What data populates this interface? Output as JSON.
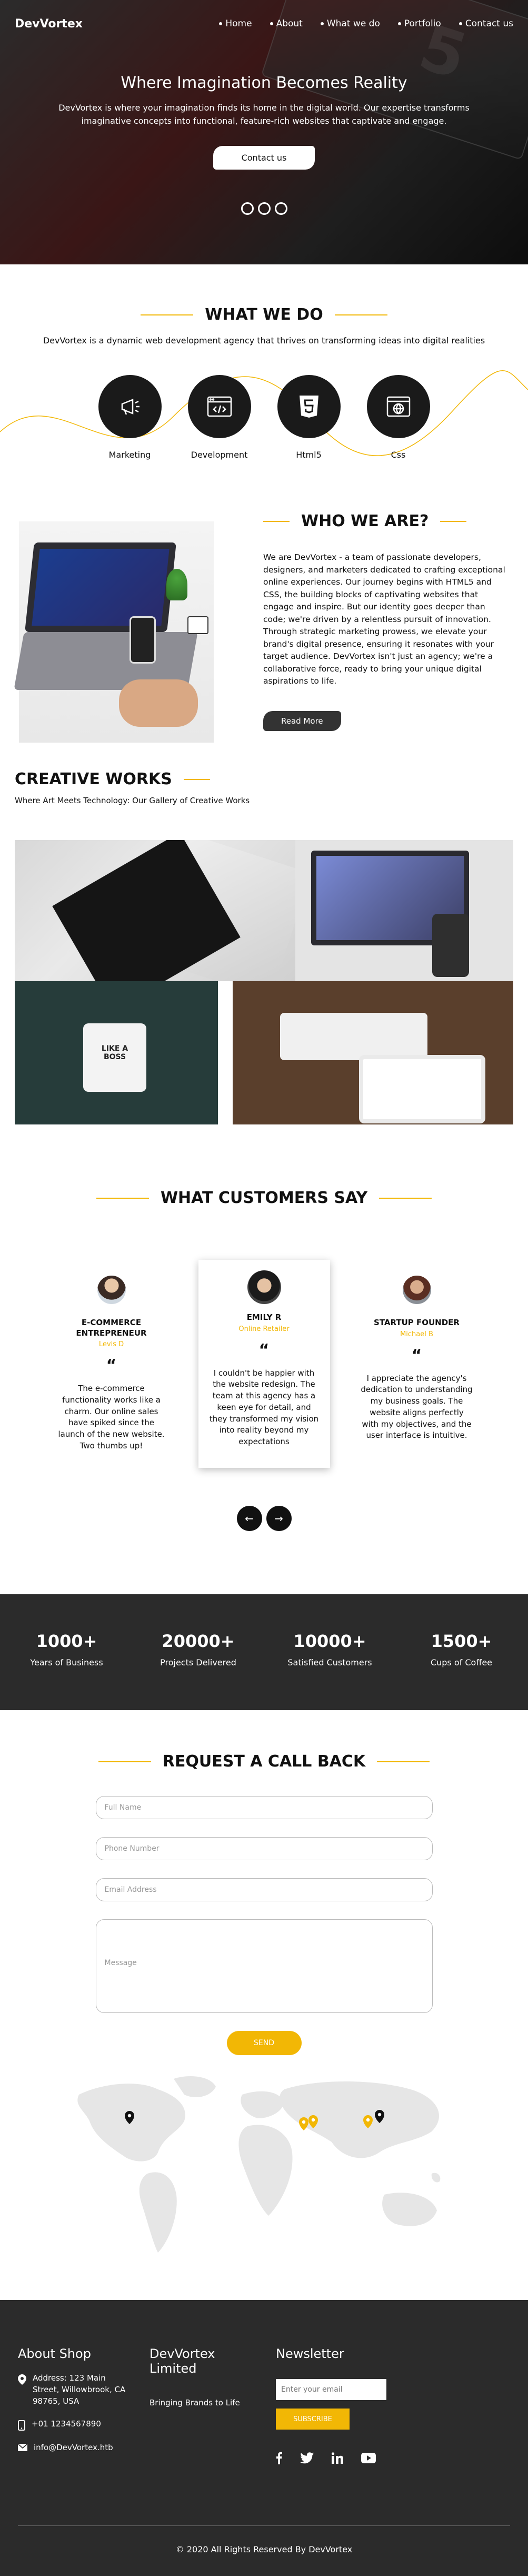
{
  "brand": "DevVortex",
  "nav": [
    "Home",
    "About",
    "What we do",
    "Portfolio",
    "Contact us"
  ],
  "hero": {
    "title": "Where Imagination Becomes Reality",
    "text": "DevVortex is where your imagination finds its home in the digital world. Our expertise transforms imaginative concepts into functional, feature-rich websites that captivate and engage.",
    "button": "Contact us"
  },
  "services": {
    "title": "WHAT WE DO",
    "subtitle": "DevVortex is a dynamic web development agency that thrives on transforming ideas into digital realities",
    "items": [
      {
        "label": "Marketing",
        "icon": "megaphone-icon"
      },
      {
        "label": "Development",
        "icon": "code-window-icon"
      },
      {
        "label": "Html5",
        "icon": "html5-icon"
      },
      {
        "label": "Css",
        "icon": "globe-window-icon"
      }
    ]
  },
  "about": {
    "title": "WHO WE ARE?",
    "text": "We are DevVortex - a team of passionate developers, designers, and marketers dedicated to crafting exceptional online experiences. Our journey begins with HTML5 and CSS, the building blocks of captivating websites that engage and inspire. But our identity goes deeper than code; we're driven by a relentless pursuit of innovation. Through strategic marketing prowess, we elevate your brand's digital presence, ensuring it resonates with your target audience. DevVortex isn't just an agency; we're a collaborative force, ready to bring your unique digital aspirations to life.",
    "button": "Read More"
  },
  "works": {
    "title": "CREATIVE WORKS",
    "subtitle": "Where Art Meets Technology: Our Gallery of Creative Works"
  },
  "testimonials": {
    "title": "WHAT CUSTOMERS SAY",
    "items": [
      {
        "name": "E-COMMERCE ENTREPRENEUR",
        "role": "Levis D",
        "text": "The e-commerce functionality works like a charm. Our online sales have spiked since the launch of the new website. Two thumbs up!"
      },
      {
        "name": "EMILY R",
        "role": "Online Retailer",
        "text": "I couldn't be happier with the website redesign. The team at this agency has a keen eye for detail, and they transformed my vision into reality beyond my expectations"
      },
      {
        "name": "STARTUP FOUNDER",
        "role": "Michael B",
        "text": "I appreciate the agency's dedication to understanding my business goals. The website aligns perfectly with my objectives, and the user interface is intuitive."
      }
    ],
    "prev": "←",
    "next": "→"
  },
  "stats": [
    {
      "num": "1000+",
      "label": "Years of Business"
    },
    {
      "num": "20000+",
      "label": "Projects Delivered"
    },
    {
      "num": "10000+",
      "label": "Satisfied Customers"
    },
    {
      "num": "1500+",
      "label": "Cups of Coffee"
    }
  ],
  "callback": {
    "title": "REQUEST A CALL BACK",
    "name_placeholder": "Full Name",
    "phone_placeholder": "Phone Number",
    "email_placeholder": "Email Address",
    "message_placeholder": "Message",
    "send": "SEND"
  },
  "footer": {
    "about_title": "About Shop",
    "address": "Address: 123 Main Street, Willowbrook, CA 98765, USA",
    "phone": "+01 1234567890",
    "email": "info@DevVortex.htb",
    "company_title": "DevVortex Limited",
    "tagline": "Bringing Brands to Life",
    "newsletter_title": "Newsletter",
    "email_placeholder": "Enter your email",
    "subscribe": "SUBSCRIBE",
    "copyright": "© 2020 All Rights Reserved By DevVortex"
  },
  "colors": {
    "accent": "#f2b705",
    "dark": "#2b2b2b",
    "hero": "#1e1e1e"
  }
}
